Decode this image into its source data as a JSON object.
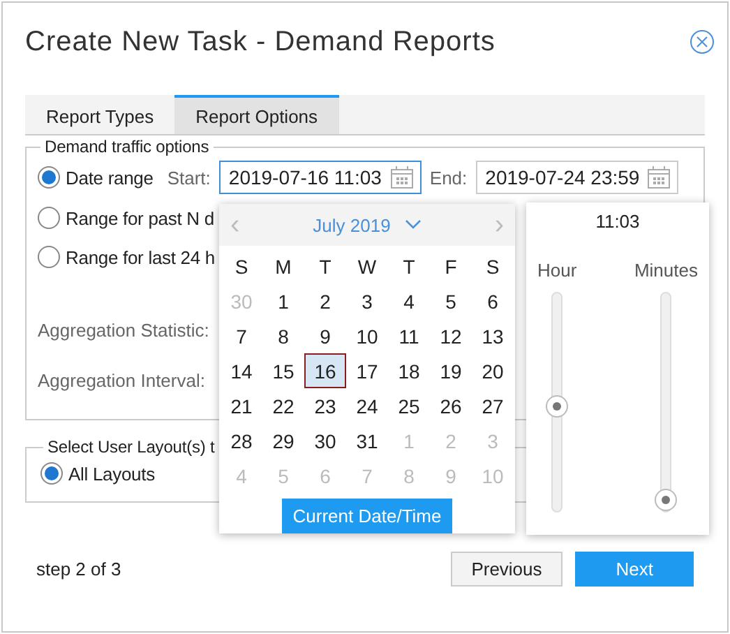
{
  "dialog": {
    "title": "Create New Task - Demand Reports"
  },
  "tabs": [
    {
      "label": "Report Types",
      "selected": false
    },
    {
      "label": "Report Options",
      "selected": true
    }
  ],
  "traffic": {
    "legend": "Demand traffic options",
    "options": [
      {
        "label": "Date range",
        "selected": true
      },
      {
        "label": "Range for past N d",
        "selected": false
      },
      {
        "label": "Range for last 24 h",
        "selected": false
      }
    ],
    "start_label": "Start:",
    "start_value": "2019-07-16 11:03",
    "end_label": "End:",
    "end_value": "2019-07-24 23:59",
    "aggregation_statistic_label": "Aggregation Statistic:",
    "aggregation_interval_label": "Aggregation Interval:"
  },
  "layouts": {
    "legend": "Select User Layout(s) t",
    "options": [
      {
        "label": "All Layouts",
        "selected": true
      }
    ]
  },
  "calendar": {
    "prev": "‹",
    "month": "July 2019",
    "next": "›",
    "weekdays": [
      "S",
      "M",
      "T",
      "W",
      "T",
      "F",
      "S"
    ],
    "weeks": [
      [
        {
          "day": "30",
          "muted": true,
          "selected": false
        },
        {
          "day": "1",
          "muted": false,
          "selected": false
        },
        {
          "day": "2",
          "muted": false,
          "selected": false
        },
        {
          "day": "3",
          "muted": false,
          "selected": false
        },
        {
          "day": "4",
          "muted": false,
          "selected": false
        },
        {
          "day": "5",
          "muted": false,
          "selected": false
        },
        {
          "day": "6",
          "muted": false,
          "selected": false
        }
      ],
      [
        {
          "day": "7",
          "muted": false,
          "selected": false
        },
        {
          "day": "8",
          "muted": false,
          "selected": false
        },
        {
          "day": "9",
          "muted": false,
          "selected": false
        },
        {
          "day": "10",
          "muted": false,
          "selected": false
        },
        {
          "day": "11",
          "muted": false,
          "selected": false
        },
        {
          "day": "12",
          "muted": false,
          "selected": false
        },
        {
          "day": "13",
          "muted": false,
          "selected": false
        }
      ],
      [
        {
          "day": "14",
          "muted": false,
          "selected": false
        },
        {
          "day": "15",
          "muted": false,
          "selected": false
        },
        {
          "day": "16",
          "muted": false,
          "selected": true
        },
        {
          "day": "17",
          "muted": false,
          "selected": false
        },
        {
          "day": "18",
          "muted": false,
          "selected": false
        },
        {
          "day": "19",
          "muted": false,
          "selected": false
        },
        {
          "day": "20",
          "muted": false,
          "selected": false
        }
      ],
      [
        {
          "day": "21",
          "muted": false,
          "selected": false
        },
        {
          "day": "22",
          "muted": false,
          "selected": false
        },
        {
          "day": "23",
          "muted": false,
          "selected": false
        },
        {
          "day": "24",
          "muted": false,
          "selected": false
        },
        {
          "day": "25",
          "muted": false,
          "selected": false
        },
        {
          "day": "26",
          "muted": false,
          "selected": false
        },
        {
          "day": "27",
          "muted": false,
          "selected": false
        }
      ],
      [
        {
          "day": "28",
          "muted": false,
          "selected": false
        },
        {
          "day": "29",
          "muted": false,
          "selected": false
        },
        {
          "day": "30",
          "muted": false,
          "selected": false
        },
        {
          "day": "31",
          "muted": false,
          "selected": false
        },
        {
          "day": "1",
          "muted": true,
          "selected": false
        },
        {
          "day": "2",
          "muted": true,
          "selected": false
        },
        {
          "day": "3",
          "muted": true,
          "selected": false
        }
      ],
      [
        {
          "day": "4",
          "muted": true,
          "selected": false
        },
        {
          "day": "5",
          "muted": true,
          "selected": false
        },
        {
          "day": "6",
          "muted": true,
          "selected": false
        },
        {
          "day": "7",
          "muted": true,
          "selected": false
        },
        {
          "day": "8",
          "muted": true,
          "selected": false
        },
        {
          "day": "9",
          "muted": true,
          "selected": false
        },
        {
          "day": "10",
          "muted": true,
          "selected": false
        }
      ]
    ],
    "now_button": "Current Date/Time"
  },
  "time": {
    "value": "11:03",
    "sliders": [
      {
        "label": "Hour",
        "level": 0.48
      },
      {
        "label": "Minutes",
        "level": 0.05
      }
    ]
  },
  "footer": {
    "step": "step 2 of 3",
    "buttons": [
      {
        "label": "Previous",
        "kind": "secondary"
      },
      {
        "label": "Next",
        "kind": "primary"
      }
    ]
  }
}
